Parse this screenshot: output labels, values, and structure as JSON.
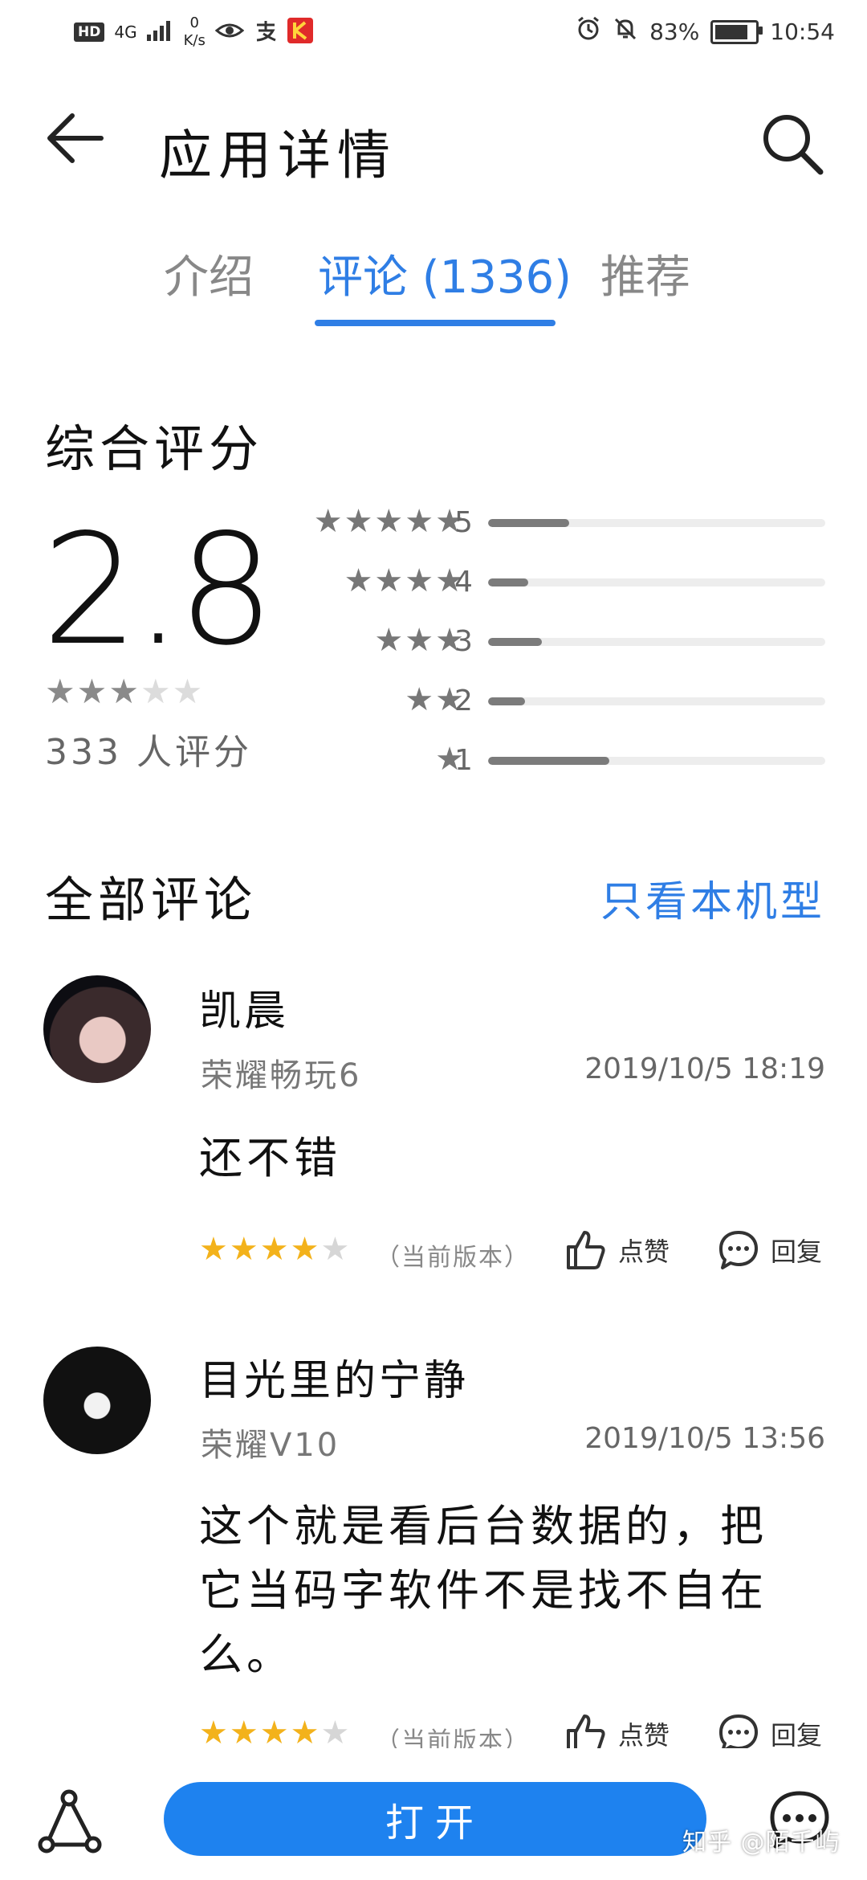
{
  "status_bar": {
    "hd": "HD",
    "network": "4G",
    "speed_value": "0",
    "speed_unit": "K/s",
    "battery_percent": "83%",
    "time": "10:54",
    "battery_level": 0.83
  },
  "header": {
    "title": "应用详情",
    "back_icon": "arrow-left-icon",
    "search_icon": "search-icon"
  },
  "tabs": [
    {
      "label": "介绍",
      "active": false
    },
    {
      "label": "评论 (1336)",
      "active": true
    },
    {
      "label": "推荐",
      "active": false
    }
  ],
  "rating": {
    "section_title": "综合评分",
    "score": "2.8",
    "stars_filled": 3,
    "stars_total": 5,
    "count_text": "333 人评分",
    "distribution": [
      {
        "stars": 5,
        "label": "5",
        "fraction": 0.24
      },
      {
        "stars": 4,
        "label": "4",
        "fraction": 0.12
      },
      {
        "stars": 3,
        "label": "3",
        "fraction": 0.16
      },
      {
        "stars": 2,
        "label": "2",
        "fraction": 0.11
      },
      {
        "stars": 1,
        "label": "1",
        "fraction": 0.36
      }
    ]
  },
  "reviews_header": {
    "title": "全部评论",
    "filter_label": "只看本机型"
  },
  "reviews": [
    {
      "name": "凯晨",
      "device": "荣耀畅玩6",
      "date": "2019/10/5 18:19",
      "body": "还不错",
      "rating": 4,
      "version_tag": "（当前版本）",
      "like_label": "点赞",
      "reply_label": "回复"
    },
    {
      "name": "目光里的宁静",
      "device": "荣耀V10",
      "date": "2019/10/5 13:56",
      "body": "这个就是看后台数据的，把它当码字软件不是找不自在么。",
      "rating": 4,
      "version_tag": "（当前版本）",
      "like_label": "点赞",
      "reply_label": "回复"
    }
  ],
  "bottom_bar": {
    "open_label": "打开",
    "share_icon": "share-icon",
    "chat_icon": "chat-icon"
  },
  "watermark": "知乎 @陌千屿",
  "colors": {
    "accent": "#2f7ee5",
    "open_button": "#1e82ef",
    "review_star": "#f3b21b"
  }
}
